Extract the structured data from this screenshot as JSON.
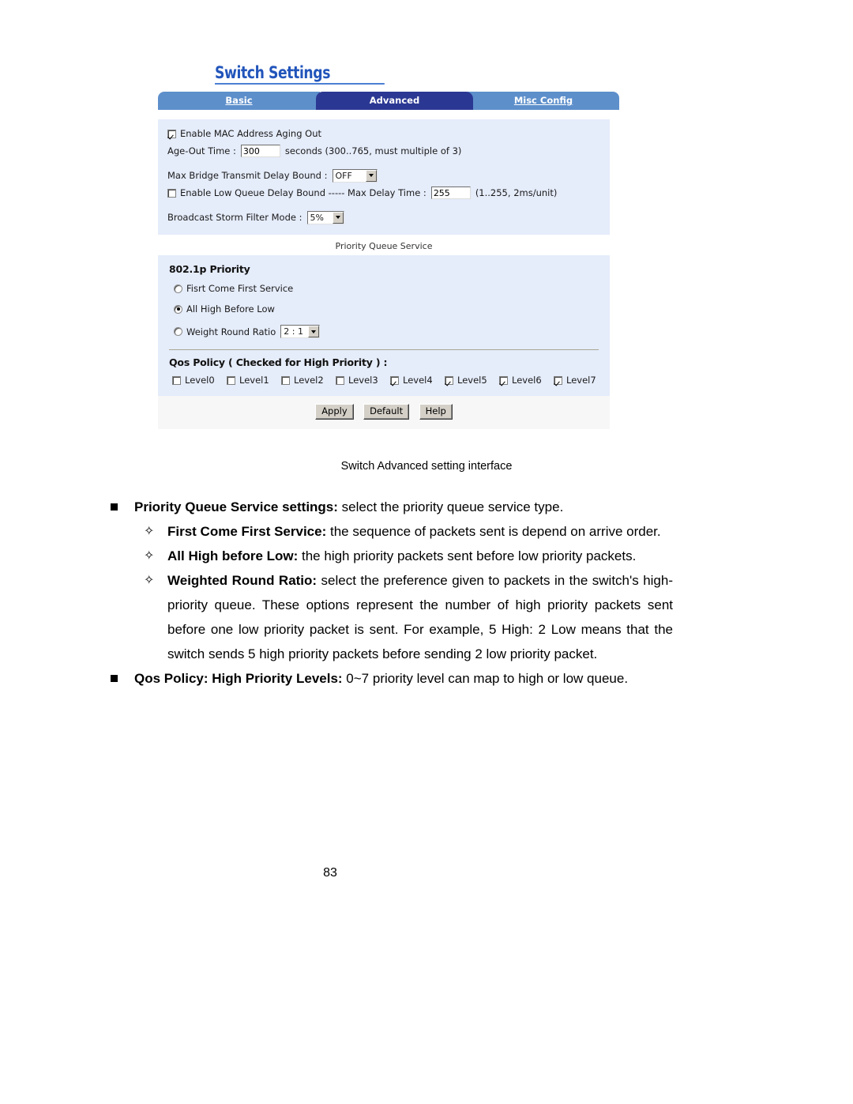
{
  "figure": {
    "title": "Switch Settings",
    "tabs": [
      {
        "label": "Basic",
        "active": false
      },
      {
        "label": "Advanced",
        "active": true
      },
      {
        "label": "Misc Config",
        "active": false
      }
    ],
    "general": {
      "aging_checkbox_label": "Enable MAC Address Aging Out",
      "aging_checked": true,
      "age_out_label": "Age-Out Time :",
      "age_out_value": "300",
      "age_out_hint": "seconds (300..765, must multiple of 3)",
      "max_bridge_label": "Max Bridge Transmit Delay Bound :",
      "max_bridge_value": "OFF",
      "low_queue_checkbox_label": "Enable Low Queue Delay Bound ----- Max Delay Time :",
      "low_queue_checked": false,
      "max_delay_value": "255",
      "max_delay_hint": "(1..255, 2ms/unit)",
      "broadcast_label": "Broadcast Storm Filter Mode :",
      "broadcast_value": "5%"
    },
    "priority_queue": {
      "caption": "Priority Queue Service",
      "heading": "802.1p Priority",
      "options": [
        {
          "label": "Fisrt Come First Service",
          "selected": false
        },
        {
          "label": "All High Before Low",
          "selected": true
        },
        {
          "label": "Weight Round Ratio",
          "selected": false,
          "ratio_value": "2 : 1"
        }
      ]
    },
    "qos_policy": {
      "heading": "Qos Policy ( Checked for High Priority ) :",
      "levels": [
        {
          "label": "Level0",
          "checked": false
        },
        {
          "label": "Level1",
          "checked": false
        },
        {
          "label": "Level2",
          "checked": false
        },
        {
          "label": "Level3",
          "checked": false
        },
        {
          "label": "Level4",
          "checked": true
        },
        {
          "label": "Level5",
          "checked": true
        },
        {
          "label": "Level6",
          "checked": true
        },
        {
          "label": "Level7",
          "checked": true
        }
      ]
    },
    "buttons": [
      {
        "label": "Apply"
      },
      {
        "label": "Default"
      },
      {
        "label": "Help"
      }
    ],
    "caption": "Switch Advanced setting interface",
    "colors": {
      "title_blue": "#2255bb",
      "tab_inactive": "#5d8fcb",
      "tab_active": "#2b3893",
      "field_bg": "#e5ecfa",
      "button_face": "#d4d0c8"
    }
  },
  "prose": {
    "item1": {
      "bold": "Priority Queue Service settings:",
      "rest": " select the priority queue service type."
    },
    "sub1": {
      "bold": "First Come First Service:",
      "rest": " the sequence of packets sent is depend on arrive order."
    },
    "sub2": {
      "bold": "All High before Low:",
      "rest": " the high priority packets sent before low priority packets."
    },
    "sub3": {
      "bold": "Weighted Round Ratio:",
      "rest": " select the preference given to packets in the switch's high-priority queue. These options represent the number of high priority packets sent before one low priority packet is sent. For example, 5 High: 2 Low means that the switch sends 5 high priority packets before sending 2 low priority packet."
    },
    "item2": {
      "bold": "Qos Policy: High Priority Levels:",
      "rest": " 0~7 priority level can map to high or low queue."
    }
  },
  "page_number": "83"
}
